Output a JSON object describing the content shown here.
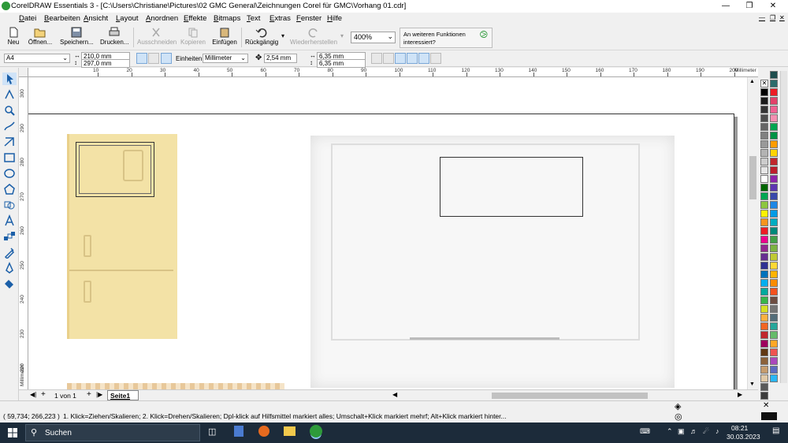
{
  "title": "CorelDRAW Essentials 3 - [C:\\Users\\Christiane\\Pictures\\02 GMC General\\Zeichnungen Corel für GMC\\Vorhang 01.cdr]",
  "menu": [
    "Datei",
    "Bearbeiten",
    "Ansicht",
    "Layout",
    "Anordnen",
    "Effekte",
    "Bitmaps",
    "Text",
    "Extras",
    "Fenster",
    "Hilfe"
  ],
  "toolbar": {
    "new": "Neu",
    "open": "Öffnen...",
    "save": "Speichern...",
    "print": "Drucken...",
    "cut": "Ausschneiden",
    "copy": "Kopieren",
    "paste": "Einfügen",
    "undo": "Rückgängig",
    "redo": "Wiederherstellen",
    "zoom": "400%",
    "promo": "An weiteren Funktionen interessiert?"
  },
  "propbar": {
    "paper": "A4",
    "width": "210,0 mm",
    "height": "297,0 mm",
    "units_label": "Einheiten:",
    "units": "Millimeter",
    "nudge": "2,54 mm",
    "dup_x": "6,35 mm",
    "dup_y": "6,35 mm"
  },
  "ruler": {
    "h_ticks": [
      "10",
      "20",
      "30",
      "40",
      "50",
      "60",
      "70",
      "80",
      "90",
      "100",
      "110",
      "120",
      "130",
      "140",
      "150",
      "160",
      "170",
      "180",
      "190",
      "200"
    ],
    "h_unit": "Millimeter",
    "v_ticks": [
      "300",
      "290",
      "280",
      "270",
      "260",
      "250",
      "240",
      "230",
      "220"
    ],
    "v_unit": "Millimeter"
  },
  "pages": {
    "count": "1 von 1",
    "tab": "Seite1"
  },
  "status": {
    "coords": "( 59,734; 266,223 )",
    "hint": "1. Klick=Ziehen/Skalieren; 2. Klick=Drehen/Skalieren; Dpl-klick auf Hilfsmittel markiert alles; Umschalt+Klick markiert mehrf; Alt+Klick markiert hinter..."
  },
  "taskbar": {
    "search": "Suchen",
    "time": "08:21",
    "date": "30.03.2023"
  },
  "colors": {
    "accent": "#2e9a3a",
    "palette_left": [
      "#000000",
      "#1a1a1a",
      "#333333",
      "#4d4d4d",
      "#666666",
      "#808080",
      "#999999",
      "#b3b3b3",
      "#cccccc",
      "#e6e6e6",
      "#ffffff",
      "#006600",
      "#00a651",
      "#8dc63f",
      "#fff200",
      "#f7941d",
      "#ed1c24",
      "#ec008c",
      "#92278f",
      "#662d91",
      "#2e3192",
      "#0072bc",
      "#00aeef",
      "#00a99d",
      "#39b54a",
      "#d7df23",
      "#fbb040",
      "#f26522",
      "#c1272d",
      "#9e005d",
      "#603813",
      "#8c6239",
      "#c69c6d",
      "#e0c9a6",
      "#5a5a5a",
      "#3c3c3c"
    ],
    "palette_right": [
      "#1f4e4e",
      "#2c6b6b",
      "#ed1c24",
      "#e3426a",
      "#f06292",
      "#f48fb1",
      "#00a651",
      "#009245",
      "#ff9c00",
      "#ffd400",
      "#c1272d",
      "#be1e2d",
      "#8e24aa",
      "#5e35b1",
      "#3949ab",
      "#1e88e5",
      "#039be5",
      "#00acc1",
      "#00897b",
      "#43a047",
      "#7cb342",
      "#c0ca33",
      "#fdd835",
      "#ffb300",
      "#fb8c00",
      "#f4511e",
      "#6d4c41",
      "#757575",
      "#546e7a",
      "#26a69a",
      "#66bb6a",
      "#ffa726",
      "#ef5350",
      "#ab47bc",
      "#5c6bc0",
      "#29b6f6"
    ]
  }
}
